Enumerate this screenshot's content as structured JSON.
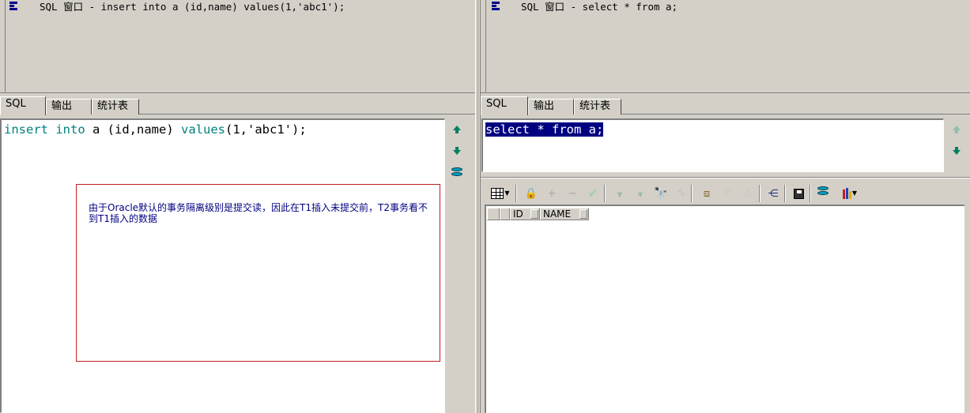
{
  "left": {
    "title": "SQL 窗口 - insert into a (id,name) values(1,'abc1');",
    "tabs": [
      "SQL",
      "输出",
      "统计表"
    ],
    "editor": {
      "kw1": "insert",
      "kw2": "into",
      "rest1": " a (id,name) ",
      "kw3": "values",
      "rest2": "(1,'abc1');"
    },
    "note": "由于Oracle默认的事务隔离级别是提交读，因此在T1插入未提交前，T2事务看不到T1插入的数据"
  },
  "right": {
    "title": "SQL 窗口 - select * from a;",
    "tabs": [
      "SQL",
      "输出",
      "统计表"
    ],
    "editor": {
      "selected": "select * from a;"
    },
    "grid": {
      "columns": [
        "ID",
        "NAME"
      ]
    }
  },
  "colors": {
    "keyword": "#008080",
    "selection": "#000080",
    "note_border": "#c02020",
    "note_text": "#000080"
  }
}
